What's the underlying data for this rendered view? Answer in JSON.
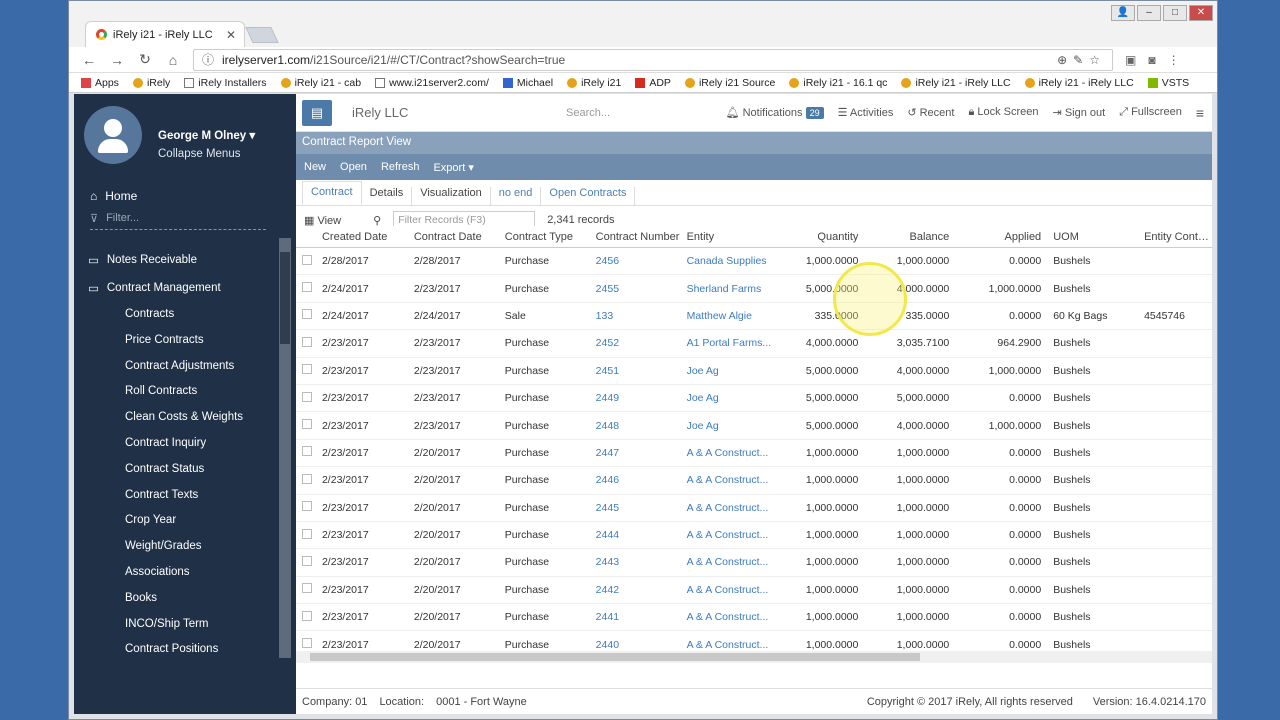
{
  "browser": {
    "tab_title": "iRely i21 - iRely LLC",
    "url_host": "irelyserver1.com",
    "url_path": "/i21Source/i21/#/CT/Contract?showSearch=true"
  },
  "bookmarks": [
    "Apps",
    "iRely",
    "iRely Installers",
    "iRely i21 - cab",
    "www.i21server2.com/",
    "Michael",
    "iRely i21",
    "ADP",
    "iRely i21 Source",
    "iRely i21 - 16.1 qc",
    "iRely i21 - iRely LLC",
    "iRely i21 - iRely LLC",
    "VSTS"
  ],
  "user": {
    "name": "George M Olney",
    "collapse": "Collapse Menus"
  },
  "sidebar": {
    "home": "Home",
    "filter_placeholder": "Filter...",
    "groups": [
      "Notes Receivable",
      "Contract Management"
    ],
    "items": [
      "Contracts",
      "Price Contracts",
      "Contract Adjustments",
      "Roll Contracts",
      "Clean Costs & Weights",
      "Contract Inquiry",
      "Contract Status",
      "Contract Texts",
      "Crop Year",
      "Weight/Grades",
      "Associations",
      "Books",
      "INCO/Ship Term",
      "Contract Positions"
    ]
  },
  "topbar": {
    "company": "iRely LLC",
    "search_placeholder": "Search...",
    "notifications": "Notifications",
    "notif_count": "29",
    "activities": "Activities",
    "recent": "Recent",
    "lock": "Lock Screen",
    "signout": "Sign out",
    "fullscreen": "Fullscreen"
  },
  "report": {
    "title": "Contract Report View",
    "tools": [
      "New",
      "Open",
      "Refresh",
      "Export"
    ],
    "tabs": [
      "Contract",
      "Details",
      "Visualization",
      "no end",
      "Open Contracts"
    ],
    "view": "View",
    "filter_placeholder": "Filter Records (F3)",
    "records": "2,341 records"
  },
  "grid": {
    "columns": [
      "Created Date",
      "Contract Date",
      "Contract Type",
      "Contract Number",
      "Entity",
      "Quantity",
      "Balance",
      "Applied",
      "UOM",
      "Entity Contract"
    ],
    "rows": [
      [
        "2/28/2017",
        "2/28/2017",
        "Purchase",
        "2456",
        "Canada Supplies",
        "1,000.0000",
        "1,000.0000",
        "0.0000",
        "Bushels",
        ""
      ],
      [
        "2/24/2017",
        "2/23/2017",
        "Purchase",
        "2455",
        "Sherland Farms",
        "5,000.0000",
        "4,000.0000",
        "1,000.0000",
        "Bushels",
        ""
      ],
      [
        "2/24/2017",
        "2/24/2017",
        "Sale",
        "133",
        "Matthew Algie",
        "335.0000",
        "335.0000",
        "0.0000",
        "60 Kg Bags",
        "4545746"
      ],
      [
        "2/23/2017",
        "2/23/2017",
        "Purchase",
        "2452",
        "A1 Portal Farms...",
        "4,000.0000",
        "3,035.7100",
        "964.2900",
        "Bushels",
        ""
      ],
      [
        "2/23/2017",
        "2/23/2017",
        "Purchase",
        "2451",
        "Joe Ag",
        "5,000.0000",
        "4,000.0000",
        "1,000.0000",
        "Bushels",
        ""
      ],
      [
        "2/23/2017",
        "2/23/2017",
        "Purchase",
        "2449",
        "Joe Ag",
        "5,000.0000",
        "5,000.0000",
        "0.0000",
        "Bushels",
        ""
      ],
      [
        "2/23/2017",
        "2/23/2017",
        "Purchase",
        "2448",
        "Joe Ag",
        "5,000.0000",
        "4,000.0000",
        "1,000.0000",
        "Bushels",
        ""
      ],
      [
        "2/23/2017",
        "2/20/2017",
        "Purchase",
        "2447",
        "A & A Construct...",
        "1,000.0000",
        "1,000.0000",
        "0.0000",
        "Bushels",
        ""
      ],
      [
        "2/23/2017",
        "2/20/2017",
        "Purchase",
        "2446",
        "A & A Construct...",
        "1,000.0000",
        "1,000.0000",
        "0.0000",
        "Bushels",
        ""
      ],
      [
        "2/23/2017",
        "2/20/2017",
        "Purchase",
        "2445",
        "A & A Construct...",
        "1,000.0000",
        "1,000.0000",
        "0.0000",
        "Bushels",
        ""
      ],
      [
        "2/23/2017",
        "2/20/2017",
        "Purchase",
        "2444",
        "A & A Construct...",
        "1,000.0000",
        "1,000.0000",
        "0.0000",
        "Bushels",
        ""
      ],
      [
        "2/23/2017",
        "2/20/2017",
        "Purchase",
        "2443",
        "A & A Construct...",
        "1,000.0000",
        "1,000.0000",
        "0.0000",
        "Bushels",
        ""
      ],
      [
        "2/23/2017",
        "2/20/2017",
        "Purchase",
        "2442",
        "A & A Construct...",
        "1,000.0000",
        "1,000.0000",
        "0.0000",
        "Bushels",
        ""
      ],
      [
        "2/23/2017",
        "2/20/2017",
        "Purchase",
        "2441",
        "A & A Construct...",
        "1,000.0000",
        "1,000.0000",
        "0.0000",
        "Bushels",
        ""
      ],
      [
        "2/23/2017",
        "2/20/2017",
        "Purchase",
        "2440",
        "A & A Construct...",
        "1,000.0000",
        "1,000.0000",
        "0.0000",
        "Bushels",
        ""
      ]
    ]
  },
  "footer": {
    "company": "Company: 01",
    "location_label": "Location:",
    "location": "0001 - Fort Wayne",
    "copyright": "Copyright © 2017 iRely, All rights reserved",
    "version": "Version: 16.4.0214.170"
  },
  "colors": {
    "sidebar": "#1f3047",
    "accent": "#4b79a8",
    "link": "#3c7bbf",
    "header": "#8aa1bc"
  }
}
